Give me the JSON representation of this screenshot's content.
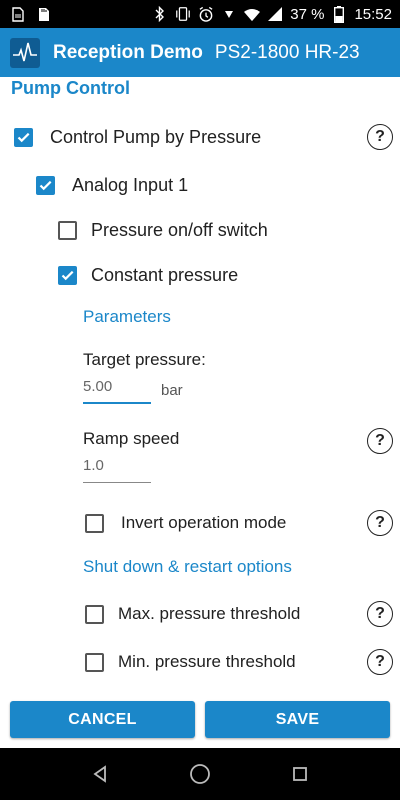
{
  "status_bar": {
    "battery_percent": "37 %",
    "time": "15:52",
    "left_icons": [
      "sim-card-icon",
      "sd-card-icon"
    ],
    "right_icons": [
      "bluetooth-icon",
      "vibrate-icon",
      "alarm-icon",
      "data-arrow-icon",
      "wifi-icon",
      "cell-signal-icon",
      "battery-icon"
    ]
  },
  "app_bar": {
    "title": "Reception Demo",
    "subtitle": "PS2-1800 HR-23",
    "icon": "heartbeat-logo-icon",
    "color": "#1b87c9"
  },
  "section": {
    "title": "Pump Control"
  },
  "options": {
    "control_pump": {
      "label": "Control Pump by Pressure",
      "checked": true
    },
    "analog_input": {
      "label": "Analog Input 1",
      "checked": true
    },
    "pressure_switch": {
      "label": "Pressure on/off switch",
      "checked": false
    },
    "constant_pressure": {
      "label": "Constant pressure",
      "checked": true
    }
  },
  "parameters": {
    "heading": "Parameters",
    "target_pressure": {
      "label": "Target pressure:",
      "value": "5.00",
      "unit": "bar"
    },
    "ramp_speed": {
      "label": "Ramp speed",
      "value": "1.0"
    },
    "invert_mode": {
      "label": "Invert operation mode",
      "checked": false
    }
  },
  "shutdown": {
    "heading": "Shut down & restart options",
    "max_threshold": {
      "label": "Max. pressure threshold",
      "checked": false
    },
    "min_threshold": {
      "label": "Min. pressure threshold",
      "checked": false
    }
  },
  "help_symbol": "?",
  "buttons": {
    "cancel": "CANCEL",
    "save": "SAVE"
  },
  "nav_bar": {
    "icons": [
      "back-icon",
      "home-icon",
      "recents-icon"
    ]
  }
}
